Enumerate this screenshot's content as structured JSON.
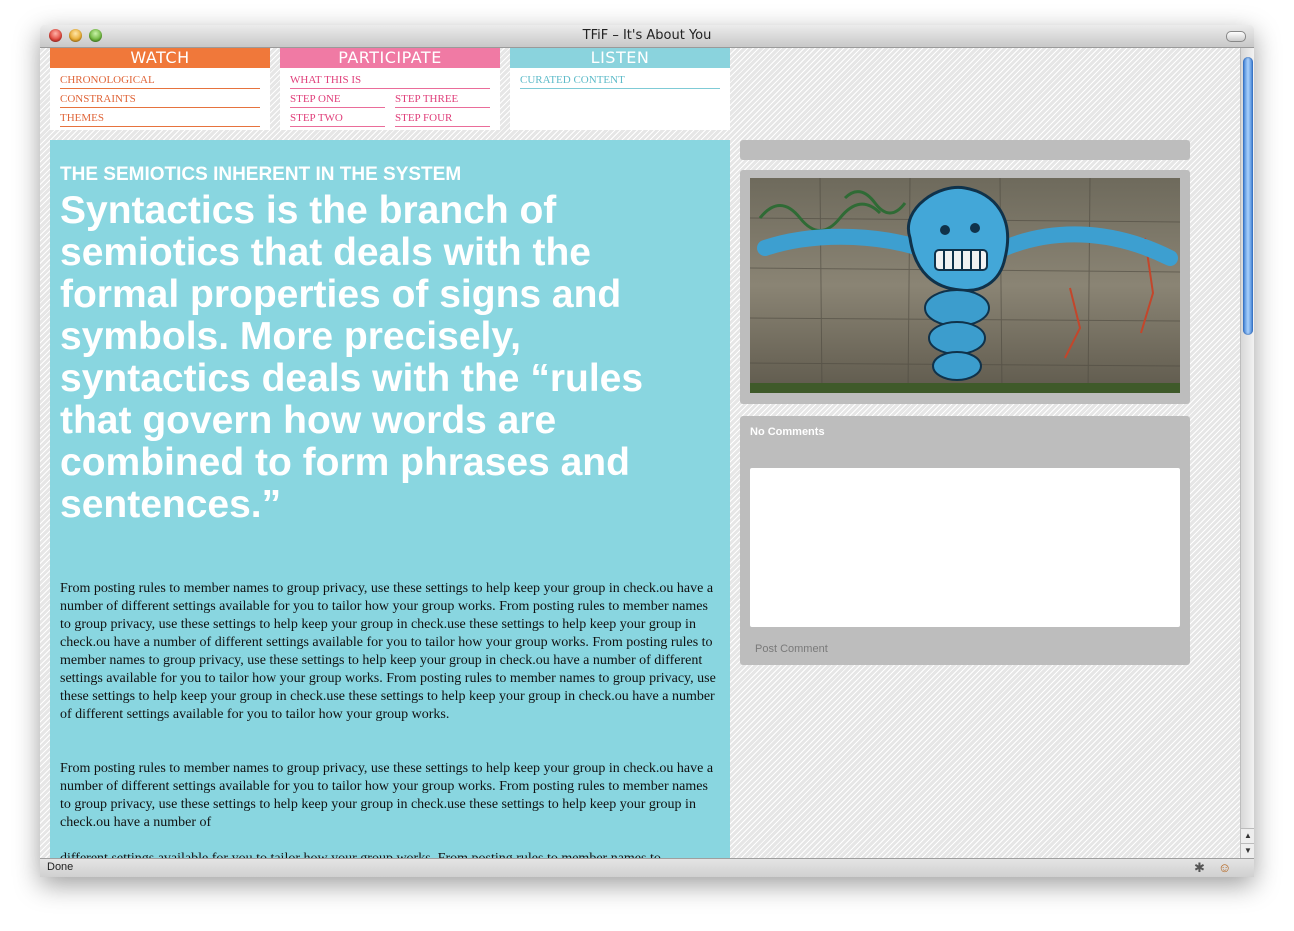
{
  "window": {
    "title": "TFiF – It's About You"
  },
  "nav": {
    "watch": {
      "heading": "WATCH",
      "color": "#f0783a",
      "links": [
        "CHRONOLOGICAL",
        "CONSTRAINTS",
        "THEMES"
      ]
    },
    "participate": {
      "heading": "PARTICIPATE",
      "color": "#f07aa4",
      "links": [
        "WHAT THIS IS",
        "STEP ONE",
        "STEP THREE",
        "STEP TWO",
        "STEP FOUR"
      ]
    },
    "listen": {
      "heading": "LISTEN",
      "color": "#8ad3dd",
      "links": [
        "CURATED CONTENT"
      ]
    }
  },
  "article": {
    "background": "#89d6e0",
    "kicker": "THE SEMIOTICS INHERENT IN THE SYSTEM",
    "headline": "Syntactics is the branch of semiotics that deals with the formal properties of signs and symbols. More precisely, syntactics deals with the “rules that govern how words are combined to form phrases and sentences.”",
    "paragraphs": [
      "From posting rules to member names to group privacy, use these settings to help keep your group in check.ou have a number of different settings available for you to tailor how your group works. From posting rules to member names to group privacy, use these settings to help keep your group in check.use these settings to help keep your group in check.ou have a number of different settings available for you to tailor how your group works. From posting rules to member names to group privacy, use these settings to help keep your group in check.ou have a number of different settings available for you to tailor how your group works. From posting rules to member names to group privacy, use these settings to help keep your group in check.use these settings to help keep your group in check.ou have a number of different settings available for you to tailor how your group works.",
      "From posting rules to member names to group privacy, use these settings to help keep your group in check.ou have a number of different settings available for you to tailor how your group works. From posting rules to member names to group privacy, use these settings to help keep your group in check.use these settings to help keep your group in check.ou have a number of",
      "different settings available for you to tailor how your group works. From posting rules to member names to"
    ]
  },
  "sidebar": {
    "photo_icon": "graffiti-photo",
    "no_comments": "No Comments",
    "comment_placeholder": "",
    "post_comment": "Post Comment"
  },
  "statusbar": {
    "text": "Done",
    "icons": [
      "bug-icon",
      "monkey-icon"
    ]
  }
}
